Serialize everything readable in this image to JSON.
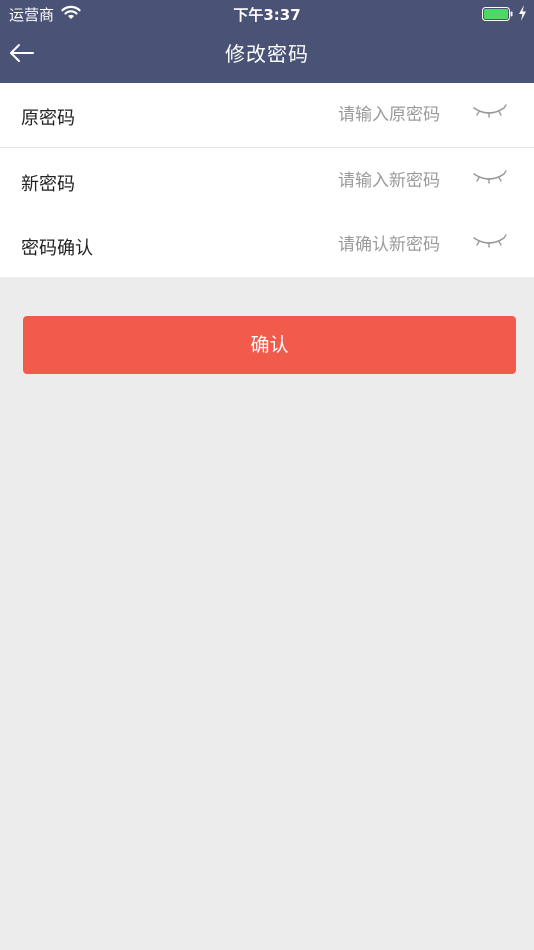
{
  "status_bar": {
    "carrier": "运营商",
    "time": "下午3:37",
    "battery_color": "#4cd964"
  },
  "nav": {
    "title": "修改密码",
    "back_icon": "arrow-left-icon",
    "background": "#4a5275"
  },
  "form": {
    "fields": [
      {
        "label": "原密码",
        "placeholder": "请输入原密码",
        "value": "",
        "toggle_icon": "eye-closed-icon"
      },
      {
        "label": "新密码",
        "placeholder": "请输入新密码",
        "value": "",
        "toggle_icon": "eye-closed-icon"
      },
      {
        "label": "密码确认",
        "placeholder": "请确认新密码",
        "value": "",
        "toggle_icon": "eye-closed-icon"
      }
    ]
  },
  "confirm_button": {
    "label": "确认",
    "color": "#f25a4b"
  }
}
